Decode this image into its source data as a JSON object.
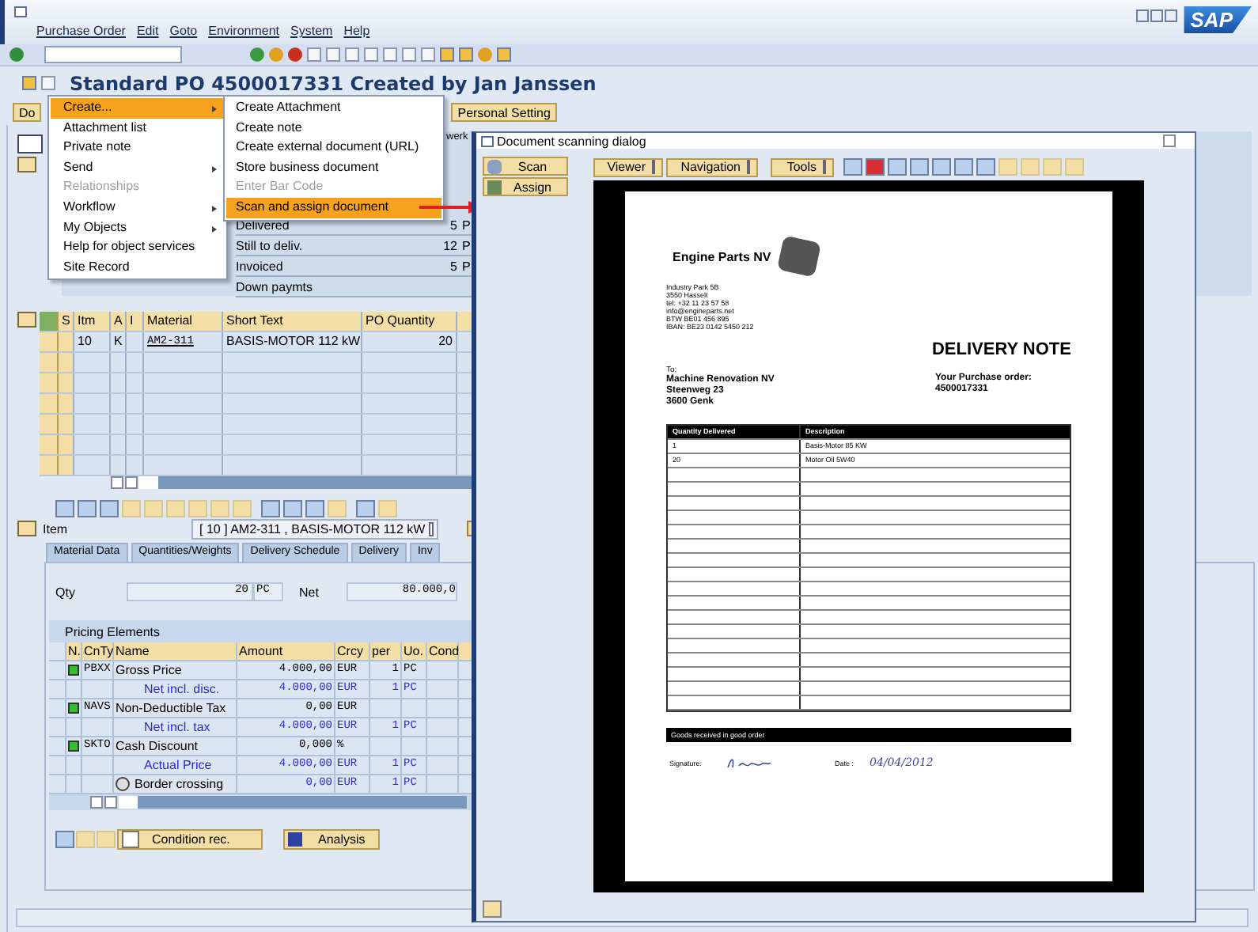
{
  "window": {
    "title": "Standard PO 4500017331 Created by Jan Janssen"
  },
  "menu_bar": [
    {
      "label": "Purchase Order"
    },
    {
      "label": "Edit"
    },
    {
      "label": "Goto"
    },
    {
      "label": "Environment"
    },
    {
      "label": "System"
    },
    {
      "label": "Help"
    }
  ],
  "logo": "SAP",
  "header_buttons": [
    {
      "label": "Do"
    },
    {
      "label": "Personal Setting"
    }
  ],
  "header_tab": {
    "label": "werk"
  },
  "header_status": [
    {
      "label": "Delivered",
      "value": "5",
      "unit": "P"
    },
    {
      "label": "Still to deliv.",
      "value": "12",
      "unit": "P"
    },
    {
      "label": "Invoiced",
      "value": "5",
      "unit": "P"
    },
    {
      "label": "Down paymts"
    }
  ],
  "item_table": {
    "columns": [
      "S",
      "Itm",
      "A",
      "I",
      "Material",
      "Short Text",
      "PO Quantity"
    ],
    "rows": [
      {
        "item": "10",
        "account": "K",
        "material": "AM2-311",
        "short_text": "BASIS-MOTOR 112 kW",
        "quantity": "20"
      }
    ]
  },
  "item_selector": {
    "label": "Item",
    "value": "[ 10 ] AM2-311 , BASIS-MOTOR 112 kW"
  },
  "item_tabs": [
    {
      "label": "Material Data",
      "selected": false
    },
    {
      "label": "Quantities/Weights",
      "selected": false
    },
    {
      "label": "Delivery Schedule",
      "selected": false
    },
    {
      "label": "Delivery",
      "selected": false
    },
    {
      "label": "Inv",
      "selected": false
    }
  ],
  "quantity": {
    "label": "Qty",
    "value": "20",
    "unit": "PC"
  },
  "net": {
    "label": "Net",
    "value": "80.000,0"
  },
  "pricing": {
    "title": "Pricing Elements",
    "columns": [
      "N.",
      "CnTy",
      "Name",
      "Amount",
      "Crcy",
      "per",
      "Uo.",
      "Cond"
    ],
    "rows": [
      {
        "kind": "condition",
        "active": true,
        "type": "PBXX",
        "name": "Gross Price",
        "amount": "4.000,00",
        "currency": "EUR",
        "per": "1",
        "unit": "PC"
      },
      {
        "kind": "subtotal",
        "name": "Net incl. disc.",
        "amount": "4.000,00",
        "currency": "EUR",
        "per": "1",
        "unit": "PC"
      },
      {
        "kind": "condition",
        "active": true,
        "type": "NAVS",
        "name": "Non-Deductible Tax",
        "amount": "0,00",
        "currency": "EUR"
      },
      {
        "kind": "subtotal",
        "name": "Net incl. tax",
        "amount": "4.000,00",
        "currency": "EUR",
        "per": "1",
        "unit": "PC"
      },
      {
        "kind": "condition",
        "active": true,
        "type": "SKTO",
        "name": "Cash Discount",
        "amount": "0,000",
        "currency": "%"
      },
      {
        "kind": "subtotal",
        "name": "Actual Price",
        "amount": "4.000,00",
        "currency": "EUR",
        "per": "1",
        "unit": "PC"
      },
      {
        "kind": "info",
        "name": "Border crossing",
        "amount": "0,00",
        "currency": "EUR",
        "per": "1",
        "unit": "PC"
      }
    ]
  },
  "pricing_buttons": [
    {
      "label": "Condition rec."
    },
    {
      "label": "Analysis"
    }
  ],
  "context_menu": {
    "items": [
      {
        "label": "Create...",
        "selected": true,
        "submenu": true,
        "disabled": false
      },
      {
        "label": "Attachment list",
        "selected": false,
        "submenu": false,
        "disabled": false
      },
      {
        "label": "Private note",
        "selected": false,
        "submenu": false,
        "disabled": false
      },
      {
        "label": "Send",
        "selected": false,
        "submenu": true,
        "disabled": false
      },
      {
        "label": "Relationships",
        "selected": false,
        "submenu": false,
        "disabled": true
      },
      {
        "label": "Workflow",
        "selected": false,
        "submenu": true,
        "disabled": false
      },
      {
        "label": "My Objects",
        "selected": false,
        "submenu": true,
        "disabled": false
      },
      {
        "label": "Help for object services",
        "selected": false,
        "submenu": false,
        "disabled": false
      },
      {
        "label": "Site Record",
        "selected": false,
        "submenu": false,
        "disabled": false
      }
    ]
  },
  "submenu": {
    "items": [
      {
        "label": "Create Attachment",
        "selected": false,
        "disabled": false
      },
      {
        "label": "Create note",
        "selected": false,
        "disabled": false
      },
      {
        "label": "Create external document (URL)",
        "selected": false,
        "disabled": false
      },
      {
        "label": "Store business document",
        "selected": false,
        "disabled": false
      },
      {
        "label": "Enter Bar Code",
        "selected": false,
        "disabled": true
      },
      {
        "label": "Scan and assign document",
        "selected": true,
        "disabled": false
      }
    ]
  },
  "dialog": {
    "title": "Document scanning dialog",
    "side_buttons": [
      {
        "label": "Scan"
      },
      {
        "label": "Assign"
      }
    ],
    "toolbar_menus": [
      {
        "label": "Viewer"
      },
      {
        "label": "Navigation"
      },
      {
        "label": "Tools"
      }
    ],
    "document": {
      "company": "Engine Parts NV",
      "address": [
        "Industry Park 5B",
        "3550 Hasselt",
        "tel: +32 11 23 57 58",
        "info@engineparts.net",
        "BTW BE01 456 895",
        "IBAN: BE23 0142 5450 212"
      ],
      "heading": "DELIVERY NOTE",
      "to_label": "To:",
      "recipient": [
        "Machine Renovation NV",
        "Steenweg 23",
        "3600 Genk"
      ],
      "order_label": "Your Purchase order:",
      "order_number": "4500017331",
      "columns": [
        "Quantity Delivered",
        "Description"
      ],
      "rows": [
        {
          "quantity": "1",
          "description": "Basis-Motor 85 KW"
        },
        {
          "quantity": "20",
          "description": "Motor Oil 5W40"
        }
      ],
      "footer": "Goods received in good order",
      "signature_label": "Signature:",
      "date_label": "Date :",
      "date": "04/04/2012"
    }
  }
}
